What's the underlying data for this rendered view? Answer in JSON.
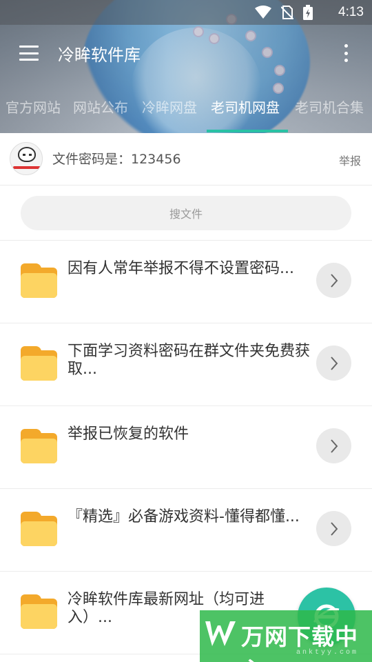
{
  "status_bar": {
    "time": "4:13"
  },
  "app_bar": {
    "title": "冷眸软件库"
  },
  "tabs": [
    {
      "label": "官方网站",
      "active": false
    },
    {
      "label": "网站公布",
      "active": false
    },
    {
      "label": "冷眸网盘",
      "active": false
    },
    {
      "label": "老司机网盘",
      "active": true
    },
    {
      "label": "老司机合集",
      "active": false
    }
  ],
  "info": {
    "password_text": "文件密码是：123456",
    "report_label": "举报"
  },
  "search": {
    "placeholder": "搜文件"
  },
  "files": [
    {
      "title": "因有人常年举报不得不设置密码..."
    },
    {
      "title": "下面学习资料密码在群文件夹免费获取..."
    },
    {
      "title": "举报已恢复的软件"
    },
    {
      "title": "『精选』必备游戏资料-懂得都懂..."
    },
    {
      "title": "冷眸软件库最新网址（均可进入）..."
    }
  ],
  "watermark": {
    "text": "万网下载中心",
    "sub": "anktyy.com"
  },
  "colors": {
    "accent": "#29c1a4",
    "folder": "#fdd462",
    "watermark": "#2eb84a"
  },
  "icons": [
    "wifi-icon",
    "no-sim-icon",
    "battery-charging-icon",
    "menu-icon",
    "more-vert-icon",
    "folder-icon",
    "chevron-right-icon",
    "browser-e-icon"
  ]
}
